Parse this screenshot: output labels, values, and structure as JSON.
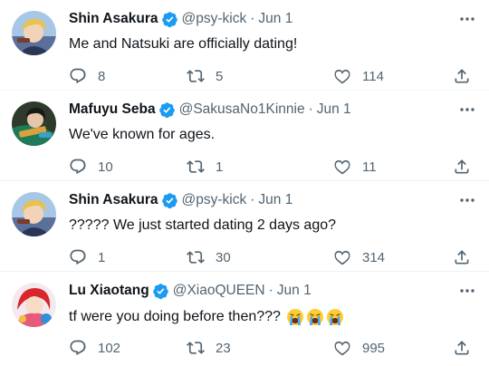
{
  "tweets": [
    {
      "name": "Shin Asakura",
      "handle": "@psy-kick",
      "separator": "·",
      "date": "Jun 1",
      "text": "Me and Natsuki are officially dating!",
      "replies": "8",
      "retweets": "5",
      "likes": "114"
    },
    {
      "name": "Mafuyu Seba",
      "handle": "@SakusaNo1Kinnie",
      "separator": "·",
      "date": "Jun 1",
      "text": "We've known for ages.",
      "replies": "10",
      "retweets": "1",
      "likes": "11"
    },
    {
      "name": "Shin Asakura",
      "handle": "@psy-kick",
      "separator": "·",
      "date": "Jun 1",
      "text": "????? We just started dating 2 days ago?",
      "replies": "1",
      "retweets": "30",
      "likes": "314"
    },
    {
      "name": "Lu Xiaotang",
      "handle": "@XiaoQUEEN",
      "separator": "·",
      "date": "Jun 1",
      "text": "tf were you doing before then???",
      "replies": "102",
      "retweets": "23",
      "likes": "995"
    }
  ],
  "icons": {
    "verified": "verified-badge-icon",
    "more": "more-options-icon",
    "reply": "reply-icon",
    "retweet": "retweet-icon",
    "like": "heart-icon",
    "share": "share-icon",
    "emoji": "loudly-crying-face-emoji"
  },
  "colors": {
    "accent": "#1d9bf0",
    "muted": "#536471",
    "text": "#0f1419",
    "divider": "#eff3f4"
  }
}
